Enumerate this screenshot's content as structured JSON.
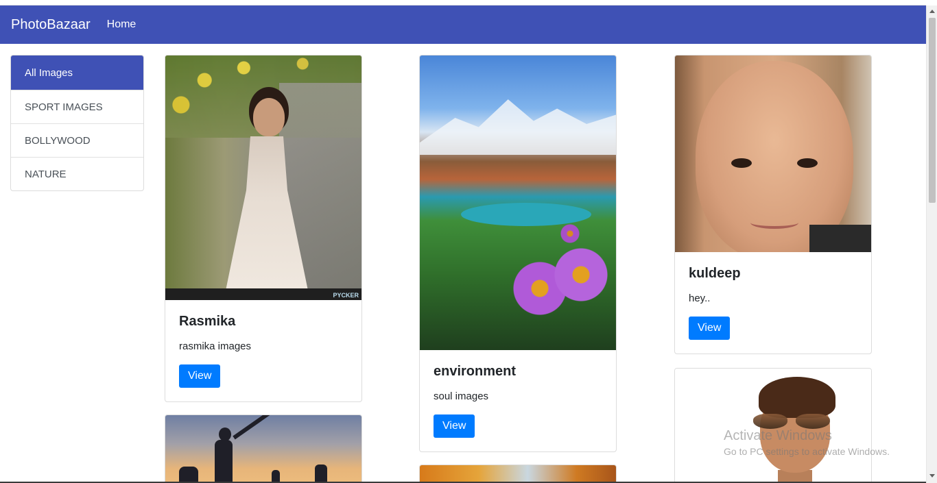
{
  "navbar": {
    "brand": "PhotoBazaar",
    "home": "Home"
  },
  "sidebar": {
    "items": [
      {
        "label": "All Images",
        "active": true
      },
      {
        "label": "SPORT IMAGES",
        "active": false
      },
      {
        "label": "BOLLYWOOD",
        "active": false
      },
      {
        "label": "NATURE",
        "active": false
      }
    ]
  },
  "cards": [
    {
      "title": "Rasmika",
      "text": "rasmika images",
      "button": "View",
      "watermark": "PYCKER"
    },
    {
      "title": "environment",
      "text": "soul images",
      "button": "View"
    },
    {
      "title": "kuldeep",
      "text": "hey..",
      "button": "View"
    }
  ],
  "overlay": {
    "activate_title": "Activate Windows",
    "activate_sub": "Go to PC settings to activate Windows."
  },
  "colors": {
    "navbar": "#3f51b5",
    "active": "#3f51b5",
    "button": "#007bff"
  }
}
